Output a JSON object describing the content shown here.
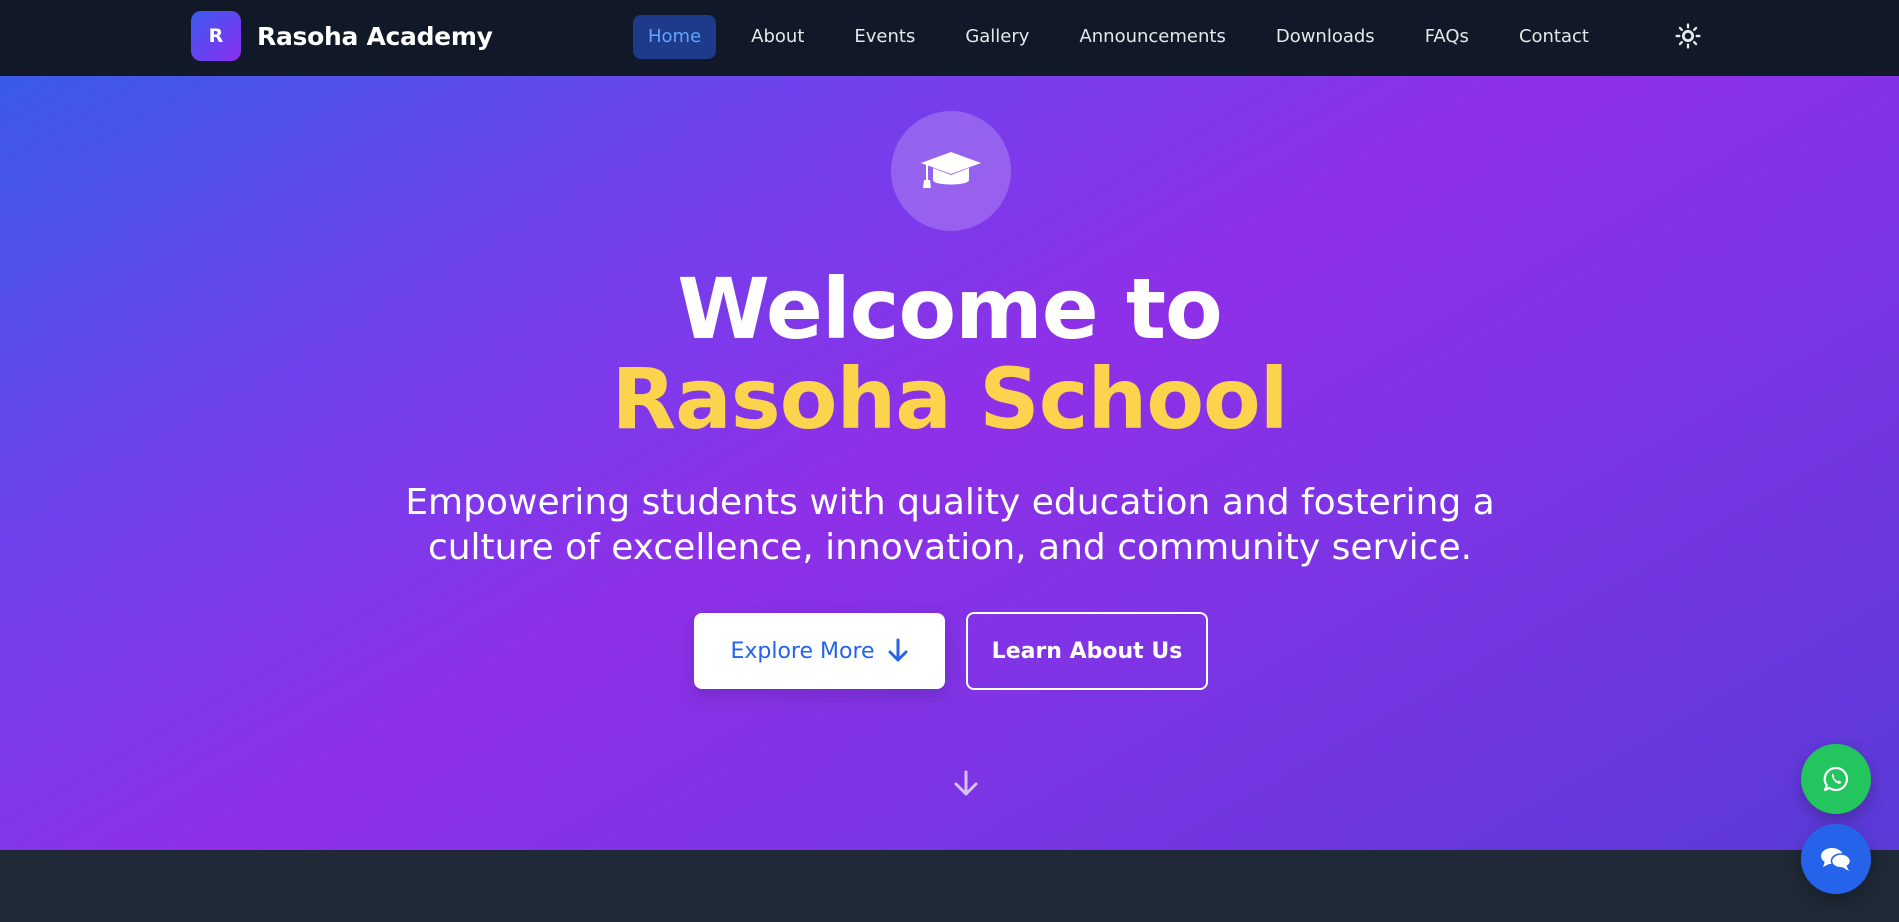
{
  "brand": {
    "logo_letter": "R",
    "name": "Rasoha Academy"
  },
  "nav": {
    "items": [
      {
        "label": "Home",
        "active": true
      },
      {
        "label": "About",
        "active": false
      },
      {
        "label": "Events",
        "active": false
      },
      {
        "label": "Gallery",
        "active": false
      },
      {
        "label": "Announcements",
        "active": false
      },
      {
        "label": "Downloads",
        "active": false
      },
      {
        "label": "FAQs",
        "active": false
      },
      {
        "label": "Contact",
        "active": false
      }
    ],
    "theme_toggle_icon": "sun-icon"
  },
  "hero": {
    "badge_icon": "graduation-cap-icon",
    "title_line1": "Welcome to",
    "title_line2": "Rasoha School",
    "subtitle": "Empowering students with quality education and fostering a culture of excellence, innovation, and community service.",
    "primary_button": "Explore More",
    "secondary_button": "Learn About Us",
    "scroll_icon": "arrow-down-icon"
  },
  "floating": {
    "whatsapp_icon": "whatsapp-icon",
    "chat_icon": "chat-icon"
  },
  "colors": {
    "navbar_bg": "#111827",
    "active_nav_bg": "#1e3a8a",
    "active_nav_text": "#60a5fa",
    "title_accent": "#fcd34d",
    "primary_button_text": "#2563eb",
    "whatsapp": "#22c55e",
    "chat": "#2563eb",
    "footer_bg": "#1f2937"
  }
}
